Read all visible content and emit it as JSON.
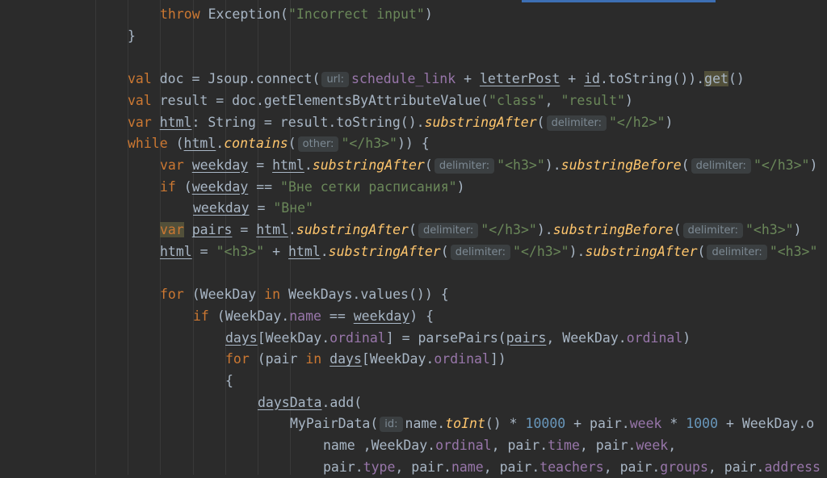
{
  "editor": {
    "lines": [
      [
        {
          "t": "throw",
          "c": "k"
        },
        {
          "t": " Exception("
        },
        {
          "t": "\"Incorrect input\"",
          "c": "s"
        },
        {
          "t": ")"
        }
      ],
      [
        {
          "t": "}"
        }
      ],
      [],
      [
        {
          "t": "val",
          "c": "k"
        },
        {
          "t": " doc = Jsoup.connect("
        },
        {
          "h": "url:"
        },
        {
          "t": "schedule_link",
          "c": "p"
        },
        {
          "t": " + "
        },
        {
          "t": "letterPost",
          "c": "u"
        },
        {
          "t": " + "
        },
        {
          "t": "id",
          "c": "u"
        },
        {
          "t": ".toString())."
        },
        {
          "t": "get",
          "c": "hl"
        },
        {
          "t": "()"
        }
      ],
      [
        {
          "t": "val",
          "c": "k"
        },
        {
          "t": " result = doc.getElementsByAttributeValue("
        },
        {
          "t": "\"class\"",
          "c": "s"
        },
        {
          "t": ", "
        },
        {
          "t": "\"result\"",
          "c": "s"
        },
        {
          "t": ")"
        }
      ],
      [
        {
          "t": "var",
          "c": "k"
        },
        {
          "t": " "
        },
        {
          "t": "html",
          "c": "u"
        },
        {
          "t": ": String = result.toString()."
        },
        {
          "t": "substringAfter",
          "c": "f"
        },
        {
          "t": "("
        },
        {
          "h": "delimiter:"
        },
        {
          "t": "\"</h2>\"",
          "c": "s"
        },
        {
          "t": ")"
        }
      ],
      [
        {
          "t": "while",
          "c": "k"
        },
        {
          "t": " ("
        },
        {
          "t": "html",
          "c": "u"
        },
        {
          "t": "."
        },
        {
          "t": "contains",
          "c": "f"
        },
        {
          "t": "("
        },
        {
          "h": "other:"
        },
        {
          "t": "\"</h3>\"",
          "c": "s"
        },
        {
          "t": ")) {"
        }
      ],
      [
        {
          "t": "var",
          "c": "k"
        },
        {
          "t": " "
        },
        {
          "t": "weekday",
          "c": "u"
        },
        {
          "t": " = "
        },
        {
          "t": "html",
          "c": "u"
        },
        {
          "t": "."
        },
        {
          "t": "substringAfter",
          "c": "f"
        },
        {
          "t": "("
        },
        {
          "h": "delimiter:"
        },
        {
          "t": "\"<h3>\"",
          "c": "s"
        },
        {
          "t": ")."
        },
        {
          "t": "substringBefore",
          "c": "f"
        },
        {
          "t": "("
        },
        {
          "h": "delimiter:"
        },
        {
          "t": "\"</h3>\"",
          "c": "s"
        },
        {
          "t": ")"
        }
      ],
      [
        {
          "t": "if",
          "c": "k"
        },
        {
          "t": " ("
        },
        {
          "t": "weekday",
          "c": "u"
        },
        {
          "t": " == "
        },
        {
          "t": "\"Вне сетки расписания\"",
          "c": "s"
        },
        {
          "t": ")"
        }
      ],
      [
        {
          "t": "weekday",
          "c": "u"
        },
        {
          "t": " = "
        },
        {
          "t": "\"Вне\"",
          "c": "s"
        }
      ],
      [
        {
          "t": "var",
          "c": "k hl"
        },
        {
          "t": " "
        },
        {
          "t": "pairs",
          "c": "u"
        },
        {
          "t": " = "
        },
        {
          "t": "html",
          "c": "u"
        },
        {
          "t": "."
        },
        {
          "t": "substringAfter",
          "c": "f"
        },
        {
          "t": "("
        },
        {
          "h": "delimiter:"
        },
        {
          "t": "\"</h3>\"",
          "c": "s"
        },
        {
          "t": ")."
        },
        {
          "t": "substringBefore",
          "c": "f"
        },
        {
          "t": "("
        },
        {
          "h": "delimiter:"
        },
        {
          "t": "\"<h3>\"",
          "c": "s"
        },
        {
          "t": ")"
        }
      ],
      [
        {
          "t": "html",
          "c": "u"
        },
        {
          "t": " = "
        },
        {
          "t": "\"<h3>\"",
          "c": "s"
        },
        {
          "t": " + "
        },
        {
          "t": "html",
          "c": "u"
        },
        {
          "t": "."
        },
        {
          "t": "substringAfter",
          "c": "f"
        },
        {
          "t": "("
        },
        {
          "h": "delimiter:"
        },
        {
          "t": "\"</h3>\"",
          "c": "s"
        },
        {
          "t": ")."
        },
        {
          "t": "substringAfter",
          "c": "f"
        },
        {
          "t": "("
        },
        {
          "h": "delimiter:"
        },
        {
          "t": "\"<h3>\"",
          "c": "s"
        }
      ],
      [],
      [
        {
          "t": "for",
          "c": "k"
        },
        {
          "t": " (WeekDay "
        },
        {
          "t": "in",
          "c": "k"
        },
        {
          "t": " WeekDays.values()) {"
        }
      ],
      [
        {
          "t": "if",
          "c": "k"
        },
        {
          "t": " (WeekDay."
        },
        {
          "t": "name",
          "c": "p"
        },
        {
          "t": " == "
        },
        {
          "t": "weekday",
          "c": "u"
        },
        {
          "t": ") {"
        }
      ],
      [
        {
          "t": "days",
          "c": "u"
        },
        {
          "t": "[WeekDay."
        },
        {
          "t": "ordinal",
          "c": "p"
        },
        {
          "t": "] = parsePairs("
        },
        {
          "t": "pairs",
          "c": "u"
        },
        {
          "t": ", WeekDay."
        },
        {
          "t": "ordinal",
          "c": "p"
        },
        {
          "t": ")"
        }
      ],
      [
        {
          "t": "for",
          "c": "k"
        },
        {
          "t": " (pair "
        },
        {
          "t": "in",
          "c": "k"
        },
        {
          "t": " "
        },
        {
          "t": "days",
          "c": "u"
        },
        {
          "t": "[WeekDay."
        },
        {
          "t": "ordinal",
          "c": "p"
        },
        {
          "t": "])"
        }
      ],
      [
        {
          "t": "{"
        }
      ],
      [
        {
          "t": "daysData",
          "c": "u"
        },
        {
          "t": ".add("
        }
      ],
      [
        {
          "t": "MyPairData("
        },
        {
          "h": "id:"
        },
        {
          "t": "name."
        },
        {
          "t": "toInt",
          "c": "f"
        },
        {
          "t": "() * "
        },
        {
          "t": "10000",
          "c": "n"
        },
        {
          "t": " + pair."
        },
        {
          "t": "week",
          "c": "p"
        },
        {
          "t": " * "
        },
        {
          "t": "1000",
          "c": "n"
        },
        {
          "t": " + WeekDay.o"
        }
      ],
      [
        {
          "t": "name ,WeekDay."
        },
        {
          "t": "ordinal",
          "c": "p"
        },
        {
          "t": ", pair."
        },
        {
          "t": "time",
          "c": "p"
        },
        {
          "t": ", pair."
        },
        {
          "t": "week",
          "c": "p"
        },
        {
          "t": ","
        }
      ],
      [
        {
          "t": "pair."
        },
        {
          "t": "type",
          "c": "p"
        },
        {
          "t": ", pair."
        },
        {
          "t": "name",
          "c": "p"
        },
        {
          "t": ", pair."
        },
        {
          "t": "teachers",
          "c": "p"
        },
        {
          "t": ", pair."
        },
        {
          "t": "groups",
          "c": "p"
        },
        {
          "t": ", pair."
        },
        {
          "t": "address",
          "c": "p"
        }
      ]
    ]
  }
}
